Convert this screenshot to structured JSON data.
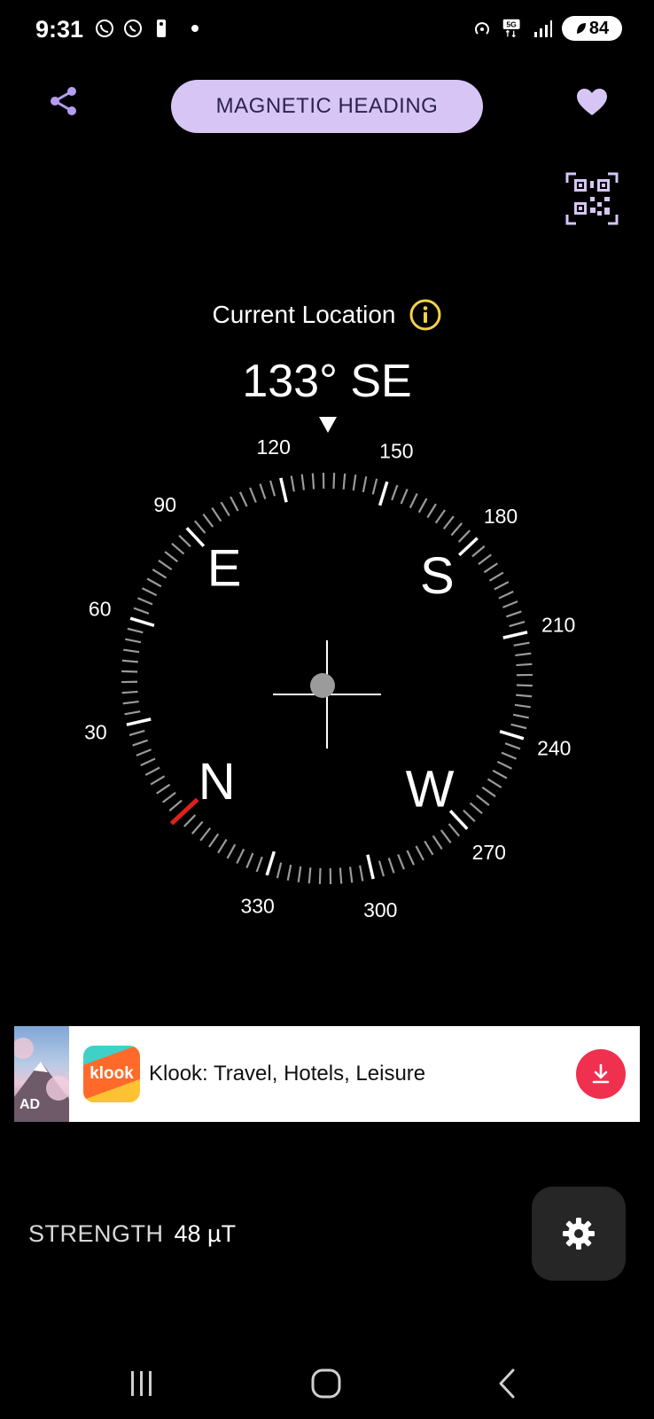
{
  "status_bar": {
    "time": "9:31",
    "battery": "84",
    "network": "5G",
    "left_icons": [
      "viber-icon",
      "whatsapp-icon",
      "nba-icon"
    ],
    "right_icons": [
      "hotspot-icon",
      "5g-icon",
      "signal-icon"
    ]
  },
  "header": {
    "mode_button": "MAGNETIC HEADING",
    "share_icon": "share-icon",
    "favorite_icon": "heart-icon",
    "qr_icon": "qr-code-icon"
  },
  "location": {
    "label": "Current Location",
    "info_icon": "info-icon"
  },
  "heading": {
    "value": "133° SE",
    "degrees": 133
  },
  "compass": {
    "cardinals": [
      "N",
      "E",
      "S",
      "W"
    ],
    "degree_labels": [
      "30",
      "60",
      "90",
      "120",
      "150",
      "180",
      "210",
      "240",
      "270",
      "300",
      "330"
    ],
    "north_marker_color": "#e0201c",
    "tick_color": "#9a9a9a",
    "major_tick_color": "#ffffff"
  },
  "ad": {
    "tag": "AD",
    "logo_text": "klook",
    "title": "Klook: Travel, Hotels, Leisure",
    "action_icon": "download-icon",
    "accent": "#f0304f"
  },
  "strength": {
    "label": "STRENGTH",
    "value": "48 µT"
  },
  "settings_icon": "gear-icon",
  "nav": {
    "recents": "recents-icon",
    "home": "home-icon",
    "back": "back-icon"
  },
  "colors": {
    "accent_pill": "#d6c5f5",
    "accent_icon": "#b39ef0",
    "info_yellow": "#f2d24a"
  }
}
